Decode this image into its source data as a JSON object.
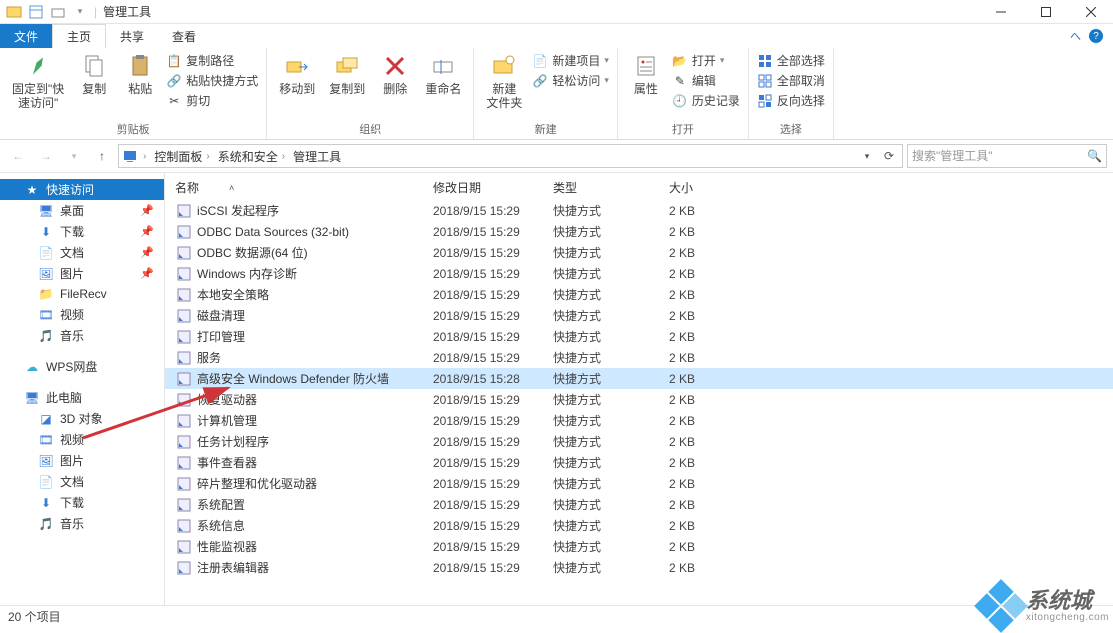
{
  "window": {
    "title": "管理工具"
  },
  "tabs": {
    "file": "文件",
    "home": "主页",
    "share": "共享",
    "view": "查看"
  },
  "ribbon": {
    "pin": "固定到\"快\n速访问\"",
    "copy": "复制",
    "paste": "粘贴",
    "copypath": "复制路径",
    "pasteshortcut": "粘贴快捷方式",
    "cut": "剪切",
    "clipboard_label": "剪贴板",
    "moveto": "移动到",
    "copyto": "复制到",
    "delete": "删除",
    "rename": "重命名",
    "organize_label": "组织",
    "newfolder": "新建\n文件夹",
    "newitem": "新建项目",
    "easyaccess": "轻松访问",
    "new_label": "新建",
    "properties": "属性",
    "open": "打开",
    "edit": "编辑",
    "history": "历史记录",
    "open_label": "打开",
    "selectall": "全部选择",
    "selectnone": "全部取消",
    "invert": "反向选择",
    "select_label": "选择"
  },
  "breadcrumb": {
    "items": [
      "控制面板",
      "系统和安全",
      "管理工具"
    ]
  },
  "search": {
    "placeholder": "搜索\"管理工具\""
  },
  "sidebar": {
    "quick": "快速访问",
    "desktop": "桌面",
    "downloads": "下载",
    "documents": "文档",
    "pictures": "图片",
    "filerecv": "FileRecv",
    "videos": "视频",
    "music": "音乐",
    "wps": "WPS网盘",
    "thispc": "此电脑",
    "objects3d": "3D 对象",
    "videos2": "视频",
    "pictures2": "图片",
    "documents2": "文档",
    "downloads2": "下载",
    "music2": "音乐"
  },
  "columns": {
    "name": "名称",
    "date": "修改日期",
    "type": "类型",
    "size": "大小"
  },
  "files": [
    {
      "name": "iSCSI 发起程序",
      "date": "2018/9/15 15:29",
      "type": "快捷方式",
      "size": "2 KB"
    },
    {
      "name": "ODBC Data Sources (32-bit)",
      "date": "2018/9/15 15:29",
      "type": "快捷方式",
      "size": "2 KB"
    },
    {
      "name": "ODBC 数据源(64 位)",
      "date": "2018/9/15 15:29",
      "type": "快捷方式",
      "size": "2 KB"
    },
    {
      "name": "Windows 内存诊断",
      "date": "2018/9/15 15:29",
      "type": "快捷方式",
      "size": "2 KB"
    },
    {
      "name": "本地安全策略",
      "date": "2018/9/15 15:29",
      "type": "快捷方式",
      "size": "2 KB"
    },
    {
      "name": "磁盘清理",
      "date": "2018/9/15 15:29",
      "type": "快捷方式",
      "size": "2 KB"
    },
    {
      "name": "打印管理",
      "date": "2018/9/15 15:29",
      "type": "快捷方式",
      "size": "2 KB"
    },
    {
      "name": "服务",
      "date": "2018/9/15 15:29",
      "type": "快捷方式",
      "size": "2 KB"
    },
    {
      "name": "高级安全 Windows Defender 防火墙",
      "date": "2018/9/15 15:28",
      "type": "快捷方式",
      "size": "2 KB"
    },
    {
      "name": "恢复驱动器",
      "date": "2018/9/15 15:29",
      "type": "快捷方式",
      "size": "2 KB"
    },
    {
      "name": "计算机管理",
      "date": "2018/9/15 15:29",
      "type": "快捷方式",
      "size": "2 KB"
    },
    {
      "name": "任务计划程序",
      "date": "2018/9/15 15:29",
      "type": "快捷方式",
      "size": "2 KB"
    },
    {
      "name": "事件查看器",
      "date": "2018/9/15 15:29",
      "type": "快捷方式",
      "size": "2 KB"
    },
    {
      "name": "碎片整理和优化驱动器",
      "date": "2018/9/15 15:29",
      "type": "快捷方式",
      "size": "2 KB"
    },
    {
      "name": "系统配置",
      "date": "2018/9/15 15:29",
      "type": "快捷方式",
      "size": "2 KB"
    },
    {
      "name": "系统信息",
      "date": "2018/9/15 15:29",
      "type": "快捷方式",
      "size": "2 KB"
    },
    {
      "name": "性能监视器",
      "date": "2018/9/15 15:29",
      "type": "快捷方式",
      "size": "2 KB"
    },
    {
      "name": "注册表编辑器",
      "date": "2018/9/15 15:29",
      "type": "快捷方式",
      "size": "2 KB"
    }
  ],
  "selected_row_index": 8,
  "status": {
    "count": "20 个项目"
  },
  "watermark": {
    "brand": "系统城",
    "url": "xitongcheng.com"
  }
}
